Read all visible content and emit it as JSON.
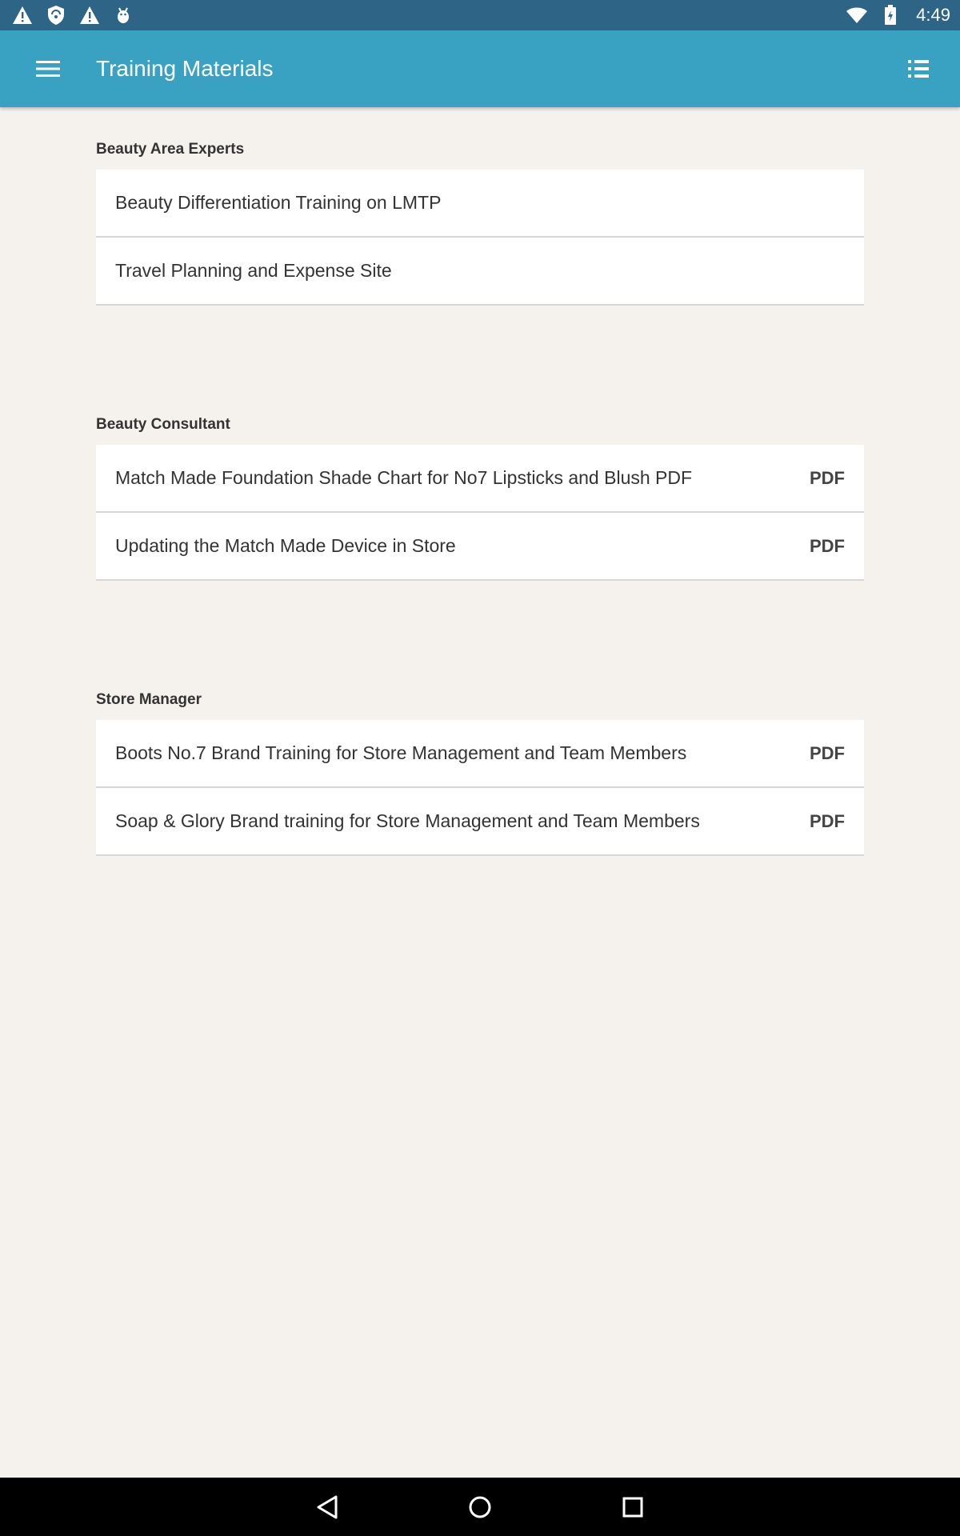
{
  "status_bar": {
    "time": "4:49",
    "left_icons": [
      "warning-icon",
      "shield-icon",
      "warning-icon",
      "android-debug-icon"
    ],
    "right_icons": [
      "wifi-icon",
      "battery-icon"
    ]
  },
  "app_bar": {
    "title": "Training Materials",
    "color": "#39a2c3"
  },
  "sections": [
    {
      "title": "Beauty Area Experts",
      "items": [
        {
          "label": "Beauty Differentiation Training on LMTP",
          "badge": ""
        },
        {
          "label": "Travel Planning and Expense Site",
          "badge": ""
        }
      ]
    },
    {
      "title": "Beauty Consultant",
      "items": [
        {
          "label": "Match Made Foundation Shade Chart for No7 Lipsticks and Blush PDF",
          "badge": "PDF"
        },
        {
          "label": "Updating the Match Made Device in Store",
          "badge": "PDF"
        }
      ]
    },
    {
      "title": "Store Manager",
      "items": [
        {
          "label": "Boots No.7 Brand Training for Store Management and Team Members",
          "badge": "PDF"
        },
        {
          "label": "Soap & Glory Brand training for Store Management and Team Members",
          "badge": "PDF"
        }
      ]
    }
  ],
  "nav_bar": {
    "buttons": [
      "back-icon",
      "home-icon",
      "recents-icon"
    ]
  }
}
